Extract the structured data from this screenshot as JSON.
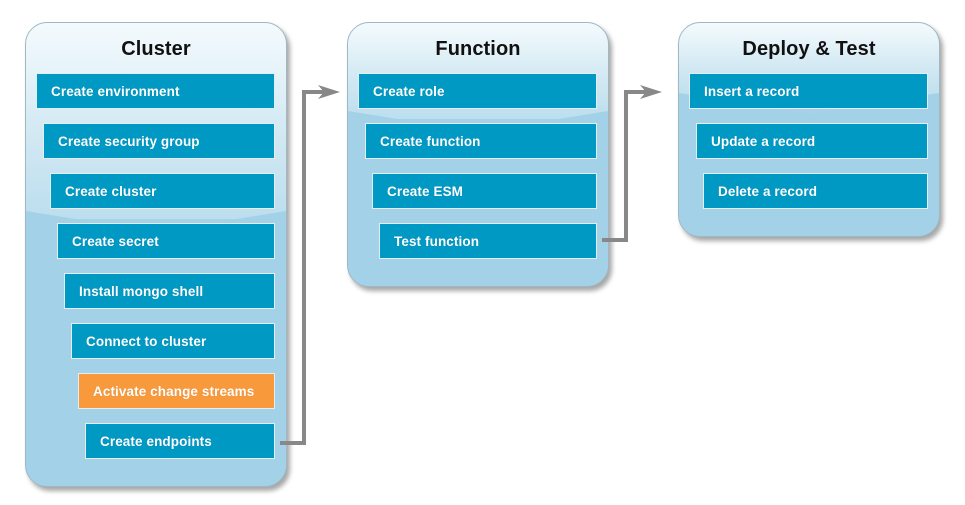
{
  "diagram": {
    "title": "Cluster / Function / Deploy & Test workflow",
    "colors": {
      "step_blue": "#0099c4",
      "step_highlight_orange": "#f89a3c",
      "panel_blue": "#a3d1e7",
      "panel_top_light": "#f4fafd",
      "connector_gray": "#888888",
      "step_text": "#ffffff",
      "title_text": "#111111"
    }
  },
  "columns": [
    {
      "id": "cluster",
      "title": "Cluster",
      "steps": [
        {
          "label": "Create environment",
          "state": "normal"
        },
        {
          "label": "Create security group",
          "state": "normal"
        },
        {
          "label": "Create cluster",
          "state": "normal"
        },
        {
          "label": "Create secret",
          "state": "normal"
        },
        {
          "label": "Install mongo shell",
          "state": "normal"
        },
        {
          "label": "Connect to cluster",
          "state": "normal"
        },
        {
          "label": "Activate change streams",
          "state": "highlight"
        },
        {
          "label": "Create endpoints",
          "state": "normal"
        }
      ]
    },
    {
      "id": "function",
      "title": "Function",
      "steps": [
        {
          "label": "Create role",
          "state": "normal"
        },
        {
          "label": "Create function",
          "state": "normal"
        },
        {
          "label": "Create ESM",
          "state": "normal"
        },
        {
          "label": "Test function",
          "state": "normal"
        }
      ]
    },
    {
      "id": "deploy-test",
      "title": "Deploy & Test",
      "steps": [
        {
          "label": "Insert a record",
          "state": "normal"
        },
        {
          "label": "Update a record",
          "state": "normal"
        },
        {
          "label": "Delete a record",
          "state": "normal"
        }
      ]
    }
  ],
  "connectors": [
    {
      "id": "cluster-to-function",
      "from": "cluster",
      "to": "function"
    },
    {
      "id": "function-to-deploy",
      "from": "function",
      "to": "deploy-test"
    }
  ]
}
